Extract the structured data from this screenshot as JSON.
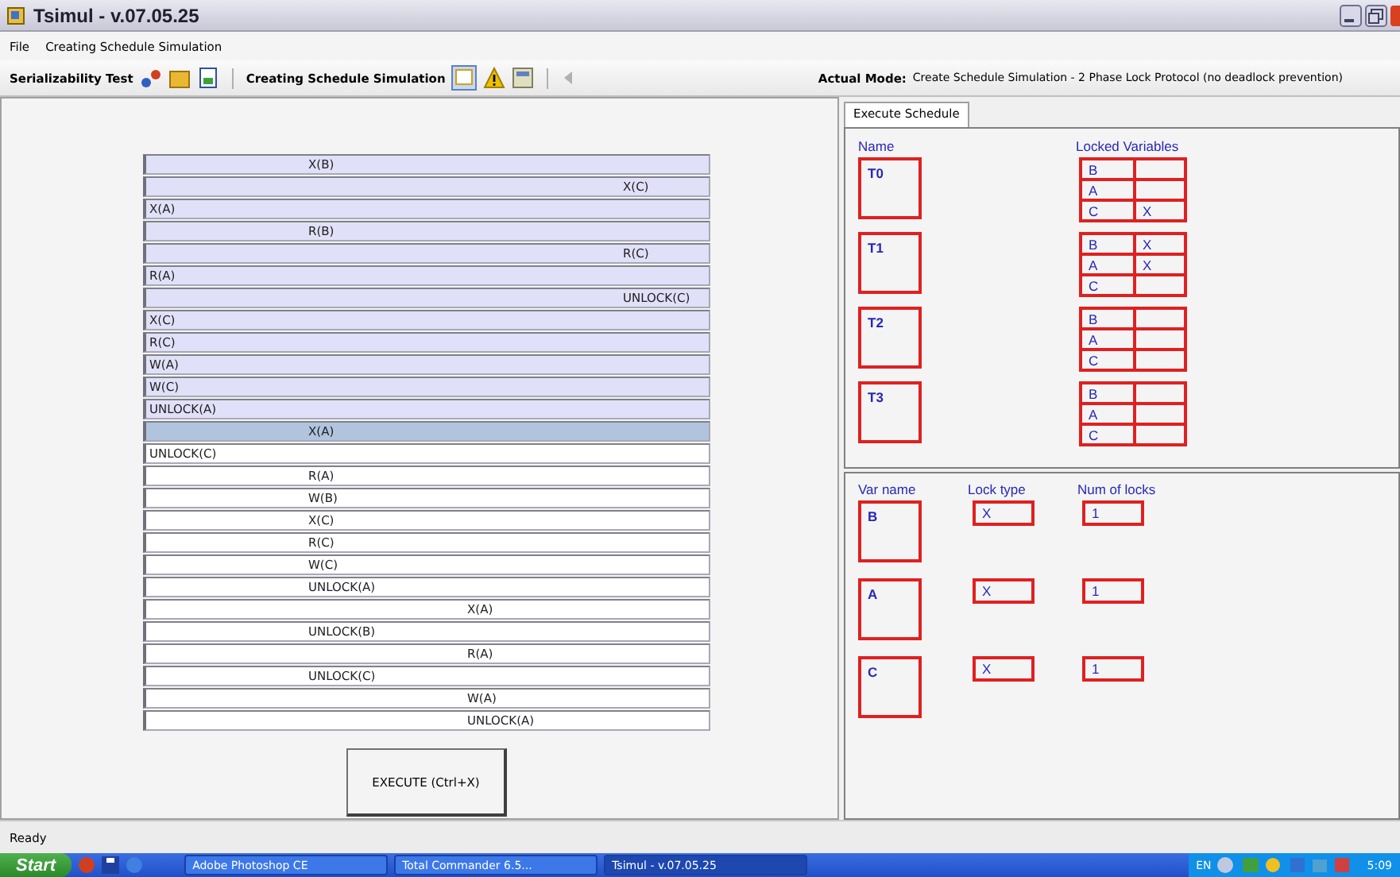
{
  "window": {
    "title": "Tsimul - v.07.05.25"
  },
  "menu": [
    "File",
    "Creating Schedule Simulation"
  ],
  "toolbar": {
    "group_1": "Serializability Test",
    "group_2": "Creating Schedule Simulation",
    "mode_label": "Actual Mode:",
    "mode_value": "Create Schedule Simulation - 2 Phase Lock Protocol (no deadlock prevention)"
  },
  "schedule": [
    {
      "text": "X(B)",
      "kind": "t1",
      "executed": true,
      "selected": false
    },
    {
      "text": "X(C)",
      "kind": "t3",
      "executed": true,
      "selected": false
    },
    {
      "text": "X(A)",
      "kind": "t0",
      "executed": true,
      "selected": false
    },
    {
      "text": "R(B)",
      "kind": "t1",
      "executed": true,
      "selected": false
    },
    {
      "text": "R(C)",
      "kind": "t3",
      "executed": true,
      "selected": false
    },
    {
      "text": "R(A)",
      "kind": "t0",
      "executed": true,
      "selected": false
    },
    {
      "text": "UNLOCK(C)",
      "kind": "t3",
      "executed": true,
      "selected": false
    },
    {
      "text": "X(C)",
      "kind": "t0",
      "executed": true,
      "selected": false
    },
    {
      "text": "R(C)",
      "kind": "t0",
      "executed": true,
      "selected": false
    },
    {
      "text": "W(A)",
      "kind": "t0",
      "executed": true,
      "selected": false
    },
    {
      "text": "W(C)",
      "kind": "t0",
      "executed": true,
      "selected": false
    },
    {
      "text": "UNLOCK(A)",
      "kind": "t0",
      "executed": true,
      "selected": false
    },
    {
      "text": "X(A)",
      "kind": "t1",
      "selected": true
    },
    {
      "text": "UNLOCK(C)",
      "kind": "t0",
      "executed": false,
      "selected": false
    },
    {
      "text": "R(A)",
      "kind": "t1",
      "executed": false,
      "selected": false
    },
    {
      "text": "W(B)",
      "kind": "t1",
      "executed": false,
      "selected": false
    },
    {
      "text": "X(C)",
      "kind": "t1",
      "executed": false,
      "selected": false
    },
    {
      "text": "R(C)",
      "kind": "t1",
      "executed": false,
      "selected": false
    },
    {
      "text": "W(C)",
      "kind": "t1",
      "executed": false,
      "selected": false
    },
    {
      "text": "UNLOCK(A)",
      "kind": "t1",
      "executed": false,
      "selected": false
    },
    {
      "text": "X(A)",
      "kind": "t2",
      "executed": false,
      "selected": false
    },
    {
      "text": "UNLOCK(B)",
      "kind": "t1",
      "executed": false,
      "selected": false
    },
    {
      "text": "R(A)",
      "kind": "t2",
      "executed": false,
      "selected": false
    },
    {
      "text": "UNLOCK(C)",
      "kind": "t1",
      "executed": false,
      "selected": false
    },
    {
      "text": "W(A)",
      "kind": "t2",
      "executed": false,
      "selected": false
    },
    {
      "text": "UNLOCK(A)",
      "kind": "t2",
      "executed": false,
      "selected": false
    }
  ],
  "execute_button": "EXECUTE (Ctrl+X)",
  "tabs": [
    {
      "label": "Execute Schedule",
      "selected": true
    }
  ],
  "transactions": {
    "name_header": "Name",
    "locks_header": "Locked Variables",
    "items": [
      {
        "name": "T0",
        "locks": [
          {
            "var": "B"
          },
          {
            "var": "A"
          },
          {
            "var": "C",
            "type": "X"
          }
        ]
      },
      {
        "name": "T1",
        "locks": [
          {
            "var": "B",
            "type": "X"
          },
          {
            "var": "A",
            "type": "X"
          },
          {
            "var": "C"
          }
        ]
      },
      {
        "name": "T2",
        "locks": [
          {
            "var": "B"
          },
          {
            "var": "A"
          },
          {
            "var": "C"
          }
        ]
      },
      {
        "name": "T3",
        "locks": [
          {
            "var": "B"
          },
          {
            "var": "A"
          },
          {
            "var": "C"
          }
        ]
      }
    ]
  },
  "variables": {
    "headers": [
      "Var name",
      "Lock type",
      "Num of locks"
    ],
    "items": [
      {
        "name": "B",
        "lock_type": "X",
        "num_locks": "1"
      },
      {
        "name": "A",
        "lock_type": "X",
        "num_locks": "1"
      },
      {
        "name": "C",
        "lock_type": "X",
        "num_locks": "1"
      }
    ]
  },
  "status_bar": "Ready",
  "taskbar": {
    "start": "Start",
    "buttons": [
      {
        "label": "Adobe Photoshop CE",
        "selected": false
      },
      {
        "label": "Total Commander 6.5...",
        "selected": false
      },
      {
        "label": "Tsimul - v.07.05.25",
        "selected": true
      }
    ],
    "lang": "EN",
    "clock": "5:09"
  }
}
